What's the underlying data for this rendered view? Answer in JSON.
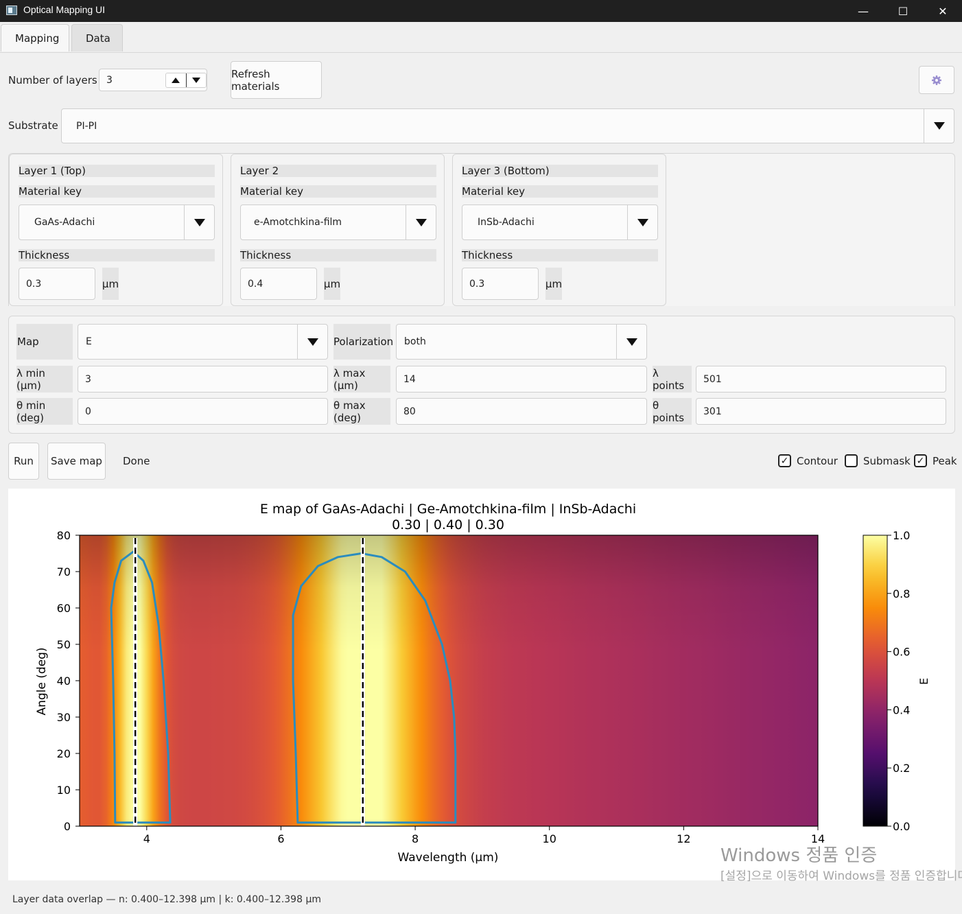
{
  "window": {
    "title": "Optical Mapping UI",
    "minimize": "—",
    "maximize": "☐",
    "close": "✕"
  },
  "tabs": [
    {
      "label": "Mapping",
      "active": true
    },
    {
      "label": "Data",
      "active": false
    }
  ],
  "controls": {
    "num_layers_label": "Number of layers",
    "num_layers_value": "3",
    "refresh_label": "Refresh materials",
    "substrate_label": "Substrate",
    "substrate_value": "PI-PI"
  },
  "layers": [
    {
      "title": "Layer 1 (Top)",
      "material_label": "Material key",
      "material": "GaAs-Adachi",
      "thickness_label": "Thickness",
      "thickness": "0.3",
      "unit": "µm"
    },
    {
      "title": "Layer 2",
      "material_label": "Material key",
      "material": "e-Amotchkina-film",
      "thickness_label": "Thickness",
      "thickness": "0.4",
      "unit": "µm"
    },
    {
      "title": "Layer 3 (Bottom)",
      "material_label": "Material key",
      "material": "InSb-Adachi",
      "thickness_label": "Thickness",
      "thickness": "0.3",
      "unit": "µm"
    }
  ],
  "params": {
    "map_label": "Map",
    "map_value": "E",
    "pol_label": "Polarization",
    "pol_value": "both",
    "lmin_label": "λ min (µm)",
    "lmin_value": "3",
    "lmax_label": "λ max (µm)",
    "lmax_value": "14",
    "lpts_label": "λ points",
    "lpts_value": "501",
    "tmin_label": "θ min (deg)",
    "tmin_value": "0",
    "tmax_label": "θ max (deg)",
    "tmax_value": "80",
    "tpts_label": "θ points",
    "tpts_value": "301"
  },
  "actions": {
    "run": "Run",
    "save": "Save map",
    "status": "Done",
    "contour": "Contour",
    "contour_checked": true,
    "submask": "Submask",
    "submask_checked": false,
    "peak": "Peak",
    "peak_checked": true
  },
  "chart_data": {
    "type": "heatmap",
    "title": "E map of GaAs-Adachi | Ge-Amotchkina-film | InSb-Adachi",
    "subtitle": "0.30 | 0.40 | 0.30",
    "xlabel": "Wavelength (µm)",
    "ylabel": "Angle (deg)",
    "xlim": [
      3,
      14
    ],
    "ylim": [
      0,
      80
    ],
    "xticks": [
      4,
      6,
      8,
      10,
      12,
      14
    ],
    "yticks": [
      0,
      10,
      20,
      30,
      40,
      50,
      60,
      70,
      80
    ],
    "colorbar_label": "E",
    "colorbar_ticks": [
      0.0,
      0.2,
      0.4,
      0.6,
      0.8,
      1.0
    ],
    "colorbar_range": [
      0,
      1
    ],
    "colormap": "inferno",
    "peaks_wavelength": [
      3.83,
      7.22
    ],
    "contour_color": "#2b8cbe",
    "contours": [
      {
        "name": "peak-1",
        "points": [
          [
            3.53,
            1
          ],
          [
            3.52,
            20
          ],
          [
            3.5,
            40
          ],
          [
            3.47,
            60
          ],
          [
            3.52,
            67
          ],
          [
            3.62,
            73
          ],
          [
            3.8,
            75.5
          ],
          [
            3.95,
            73
          ],
          [
            4.08,
            67
          ],
          [
            4.18,
            55
          ],
          [
            4.25,
            40
          ],
          [
            4.32,
            20
          ],
          [
            4.35,
            1
          ]
        ]
      },
      {
        "name": "peak-2",
        "points": [
          [
            6.25,
            1
          ],
          [
            6.22,
            20
          ],
          [
            6.18,
            40
          ],
          [
            6.18,
            58
          ],
          [
            6.3,
            66
          ],
          [
            6.55,
            71.5
          ],
          [
            6.85,
            74
          ],
          [
            7.2,
            75
          ],
          [
            7.5,
            74
          ],
          [
            7.85,
            70
          ],
          [
            8.15,
            62
          ],
          [
            8.4,
            50
          ],
          [
            8.52,
            40
          ],
          [
            8.58,
            30
          ],
          [
            8.6,
            20
          ],
          [
            8.6,
            1
          ]
        ]
      }
    ]
  },
  "watermark": {
    "line1": "Windows 정품 인증",
    "line2": "[설정]으로 이동하여 Windows를 정품 인증합니다."
  },
  "status_bar": "Layer data overlap — n: 0.400–12.398 µm | k: 0.400–12.398 µm"
}
